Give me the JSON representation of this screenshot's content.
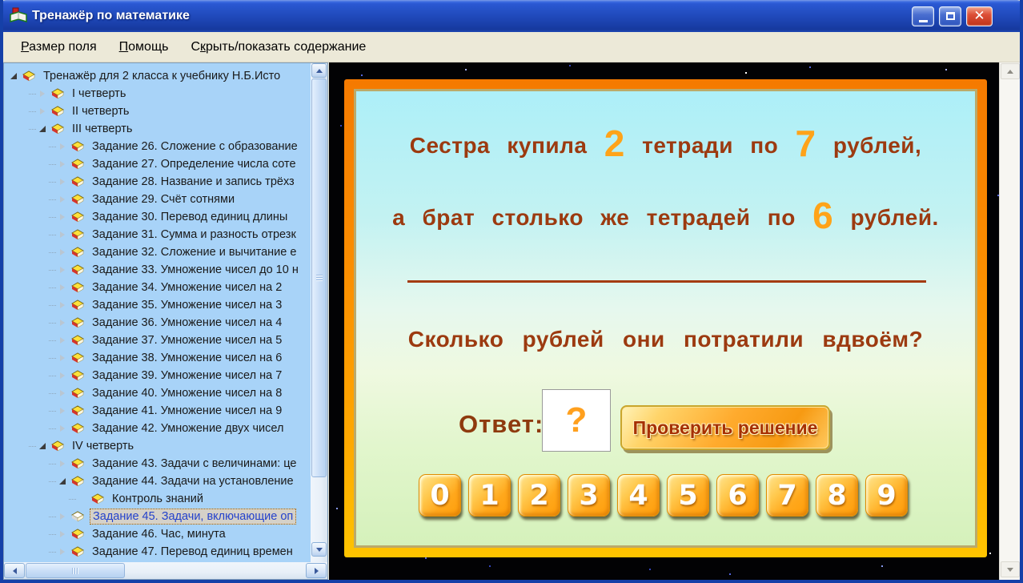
{
  "window": {
    "title": "Тренажёр по математике"
  },
  "menu": {
    "items": [
      {
        "pre": "",
        "key": "Р",
        "post": "азмер поля"
      },
      {
        "pre": "",
        "key": "П",
        "post": "омощь"
      },
      {
        "pre": "С",
        "key": "к",
        "post": "рыть/показать содержание"
      }
    ]
  },
  "tree": {
    "items": [
      {
        "label": "Тренажёр для 2 класса к учебнику Н.Б.Исто",
        "level": 0,
        "state": "expanded",
        "icon": "yellow",
        "selected": false
      },
      {
        "label": "I четверть",
        "level": 1,
        "state": "collapsed",
        "icon": "yellow",
        "selected": false
      },
      {
        "label": "II четверть",
        "level": 1,
        "state": "collapsed",
        "icon": "yellow",
        "selected": false
      },
      {
        "label": "III четверть",
        "level": 1,
        "state": "expanded",
        "icon": "yellow",
        "selected": false
      },
      {
        "label": "Задание 26. Сложение с образование",
        "level": 2,
        "state": "collapsed",
        "icon": "yellow",
        "selected": false
      },
      {
        "label": "Задание 27. Определение числа соте",
        "level": 2,
        "state": "collapsed",
        "icon": "yellow",
        "selected": false
      },
      {
        "label": "Задание 28. Название и запись трёхз",
        "level": 2,
        "state": "collapsed",
        "icon": "yellow",
        "selected": false
      },
      {
        "label": "Задание 29. Счёт сотнями",
        "level": 2,
        "state": "collapsed",
        "icon": "yellow",
        "selected": false
      },
      {
        "label": "Задание 30. Перевод единиц длины",
        "level": 2,
        "state": "collapsed",
        "icon": "yellow",
        "selected": false
      },
      {
        "label": "Задание 31. Сумма и разность отрезк",
        "level": 2,
        "state": "collapsed",
        "icon": "yellow",
        "selected": false
      },
      {
        "label": "Задание 32. Сложение и вычитание е",
        "level": 2,
        "state": "collapsed",
        "icon": "yellow",
        "selected": false
      },
      {
        "label": "Задание 33. Умножение чисел до 10 н",
        "level": 2,
        "state": "collapsed",
        "icon": "yellow",
        "selected": false
      },
      {
        "label": "Задание 34. Умножение чисел на 2",
        "level": 2,
        "state": "collapsed",
        "icon": "yellow",
        "selected": false
      },
      {
        "label": "Задание 35. Умножение чисел на 3",
        "level": 2,
        "state": "collapsed",
        "icon": "yellow",
        "selected": false
      },
      {
        "label": "Задание 36. Умножение чисел на 4",
        "level": 2,
        "state": "collapsed",
        "icon": "yellow",
        "selected": false
      },
      {
        "label": "Задание 37. Умножение чисел на 5",
        "level": 2,
        "state": "collapsed",
        "icon": "yellow",
        "selected": false
      },
      {
        "label": "Задание 38. Умножение чисел на 6",
        "level": 2,
        "state": "collapsed",
        "icon": "yellow",
        "selected": false
      },
      {
        "label": "Задание 39. Умножение чисел на 7",
        "level": 2,
        "state": "collapsed",
        "icon": "yellow",
        "selected": false
      },
      {
        "label": "Задание 40. Умножение чисел на 8",
        "level": 2,
        "state": "collapsed",
        "icon": "yellow",
        "selected": false
      },
      {
        "label": "Задание 41. Умножение чисел на 9",
        "level": 2,
        "state": "collapsed",
        "icon": "yellow",
        "selected": false
      },
      {
        "label": "Задание 42. Умножение двух чисел",
        "level": 2,
        "state": "collapsed",
        "icon": "yellow",
        "selected": false
      },
      {
        "label": "IV четверть",
        "level": 1,
        "state": "expanded",
        "icon": "yellow",
        "selected": false
      },
      {
        "label": "Задание 43. Задачи с величинами: це",
        "level": 2,
        "state": "collapsed",
        "icon": "yellow",
        "selected": false
      },
      {
        "label": "Задание 44. Задачи на установление",
        "level": 2,
        "state": "expanded",
        "icon": "yellow",
        "selected": false
      },
      {
        "label": "Контроль знаний",
        "level": 3,
        "state": "leaf",
        "icon": "yellow",
        "selected": false
      },
      {
        "label": "Задание 45. Задачи, включающие оп",
        "level": 2,
        "state": "collapsed",
        "icon": "white",
        "selected": true
      },
      {
        "label": "Задание 46. Час, минута",
        "level": 2,
        "state": "collapsed",
        "icon": "yellow",
        "selected": false
      },
      {
        "label": "Задание 47. Перевод единиц времен",
        "level": 2,
        "state": "collapsed",
        "icon": "yellow",
        "selected": false
      }
    ]
  },
  "content": {
    "line1": [
      "Сестра купила ",
      "2",
      " тетради по ",
      "7",
      " рублей,"
    ],
    "line2": [
      "а брат столько же тетрадей по ",
      "6",
      " рублей."
    ],
    "question": "Сколько рублей они потратили вдвоём?",
    "answer_label": "Ответ:",
    "answer_value": "?",
    "check_button": "Проверить решение",
    "digits": [
      "0",
      "1",
      "2",
      "3",
      "4",
      "5",
      "6",
      "7",
      "8",
      "9"
    ]
  },
  "colors": {
    "frame_orange": "#F57A00",
    "problem_text_brown": "#9C3A10",
    "number_orange": "#FFA319",
    "tree_background": "#A8D3F8",
    "titlebar_blue": "#1F48B8"
  }
}
